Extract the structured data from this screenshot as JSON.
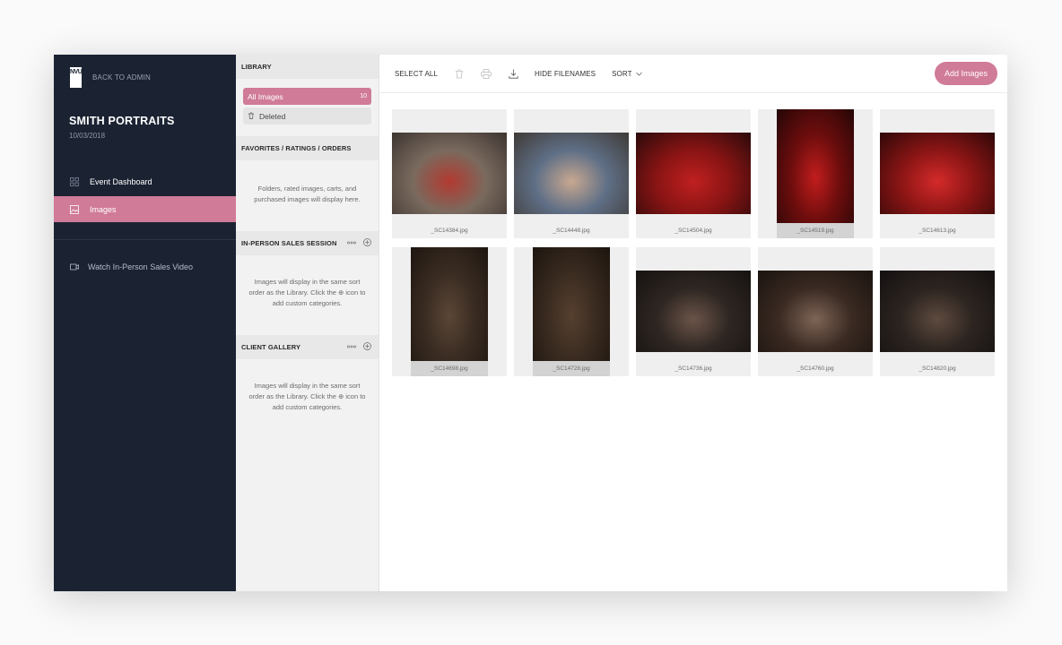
{
  "sidebar": {
    "logo_text": "NVU",
    "back_label": "BACK TO ADMIN",
    "event_title": "SMITH PORTRAITS",
    "event_date": "10/03/2018",
    "nav": [
      {
        "label": "Event Dashboard",
        "icon": "grid-icon",
        "active": false
      },
      {
        "label": "Images",
        "icon": "image-icon",
        "active": true
      }
    ],
    "video_label": "Watch In-Person Sales Video"
  },
  "panel": {
    "library_head": "LIBRARY",
    "library_items": [
      {
        "label": "All Images",
        "count": "10",
        "active": true
      },
      {
        "label": "Deleted",
        "count": "",
        "active": false
      }
    ],
    "favorites_head": "FAVORITES / RATINGS / ORDERS",
    "favorites_msg": "Folders, rated images, carts, and purchased images will display here.",
    "inperson_head": "IN-PERSON SALES SESSION",
    "inperson_msg": "Images will display in the same sort order as the Library. Click the ⊕ icon to add custom categories.",
    "client_head": "CLIENT GALLERY",
    "client_msg": "Images will display in the same sort order as the Library. Click the ⊕ icon to add custom categories."
  },
  "toolbar": {
    "select_all": "SELECT ALL",
    "hide_filenames": "HIDE FILENAMES",
    "sort": "SORT",
    "add_images": "Add Images"
  },
  "images": [
    {
      "filename": "_SC14384.jpg",
      "orientation": "landscape",
      "palette": [
        "#7a6a5e",
        "#b23a30",
        "#3c3430"
      ]
    },
    {
      "filename": "_SC14448.jpg",
      "orientation": "landscape",
      "palette": [
        "#5f6f86",
        "#c8a890",
        "#3f3a36"
      ]
    },
    {
      "filename": "_SC14504.jpg",
      "orientation": "landscape",
      "palette": [
        "#8a1414",
        "#c02020",
        "#2a0a0a"
      ]
    },
    {
      "filename": "_SC14519.jpg",
      "orientation": "portrait",
      "palette": [
        "#6e0d0d",
        "#c21d1d",
        "#240606"
      ]
    },
    {
      "filename": "_SC14613.jpg",
      "orientation": "landscape",
      "palette": [
        "#8c1515",
        "#d42a2a",
        "#2e0808"
      ]
    },
    {
      "filename": "_SC14698.jpg",
      "orientation": "portrait",
      "palette": [
        "#3a2c22",
        "#5b4636",
        "#1e1610"
      ]
    },
    {
      "filename": "_SC14728.jpg",
      "orientation": "portrait",
      "palette": [
        "#3a2b20",
        "#56402f",
        "#1b140e"
      ]
    },
    {
      "filename": "_SC14736.jpg",
      "orientation": "landscape",
      "palette": [
        "#2e2622",
        "#6b5448",
        "#161210"
      ]
    },
    {
      "filename": "_SC14760.jpg",
      "orientation": "landscape",
      "palette": [
        "#3a2a22",
        "#7e6456",
        "#1a130f"
      ]
    },
    {
      "filename": "_SC14820.jpg",
      "orientation": "landscape",
      "palette": [
        "#2c2420",
        "#5e4a3e",
        "#141010"
      ]
    }
  ]
}
